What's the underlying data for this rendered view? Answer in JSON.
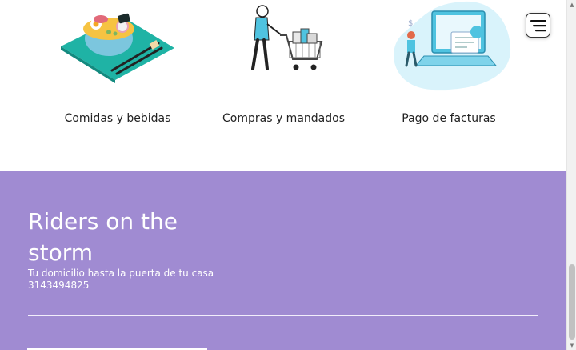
{
  "services": [
    {
      "label": "Comidas y bebidas",
      "icon": "ramen-bowl-illustration"
    },
    {
      "label": "Compras y mandados",
      "icon": "shopping-cart-illustration"
    },
    {
      "label": "Pago de facturas",
      "icon": "bill-payment-illustration"
    }
  ],
  "menu": {
    "icon": "hamburger-menu-icon"
  },
  "footer": {
    "brand": "Riders on the storm",
    "tagline": "Tu domicilio hasta la puerta de tu casa",
    "phone": "3143494825"
  },
  "colors": {
    "footer_bg": "#a08bd2",
    "accent_teal": "#1fb3a5",
    "accent_blue": "#4fc3e0"
  }
}
